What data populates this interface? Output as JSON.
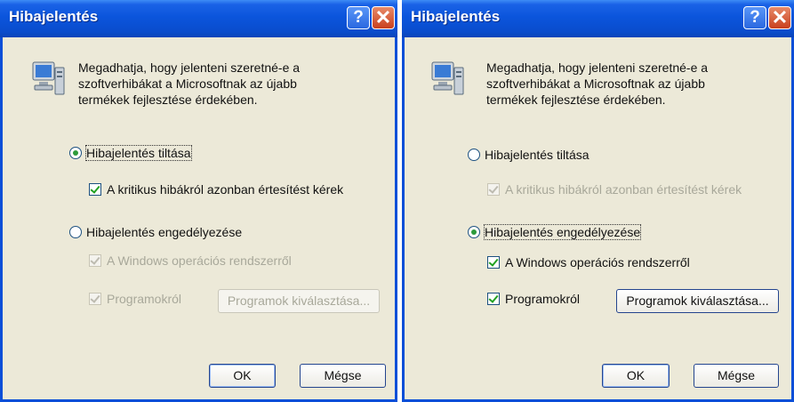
{
  "left": {
    "title": "Hibajelentés",
    "description": "Megadhatja, hogy jelenteni szeretné-e a szoftverhibákat a Microsoftnak az újabb termékek fejlesztése érdekében.",
    "radio_disable": "Hibajelentés tiltása",
    "check_critical": "A kritikus hibákról azonban értesítést kérek",
    "radio_enable": "Hibajelentés engedélyezése",
    "check_windows": "A Windows operációs rendszerről",
    "check_programs": "Programokról",
    "choose_programs": "Programok kiválasztása...",
    "ok": "OK",
    "cancel": "Mégse"
  },
  "right": {
    "title": "Hibajelentés",
    "description": "Megadhatja, hogy jelenteni szeretné-e a szoftverhibákat a Microsoftnak az újabb termékek fejlesztése érdekében.",
    "radio_disable": "Hibajelentés tiltása",
    "check_critical": "A kritikus hibákról azonban értesítést kérek",
    "radio_enable": "Hibajelentés engedélyezése",
    "check_windows": "A Windows operációs rendszerről",
    "check_programs": "Programokról",
    "choose_programs": "Programok kiválasztása...",
    "ok": "OK",
    "cancel": "Mégse"
  },
  "titlebar_buttons": {
    "help": "?",
    "close": "✕"
  },
  "colors": {
    "titlebar": "#0b55dc",
    "dialog_bg": "#ece9d8",
    "check_green": "#21a121"
  }
}
